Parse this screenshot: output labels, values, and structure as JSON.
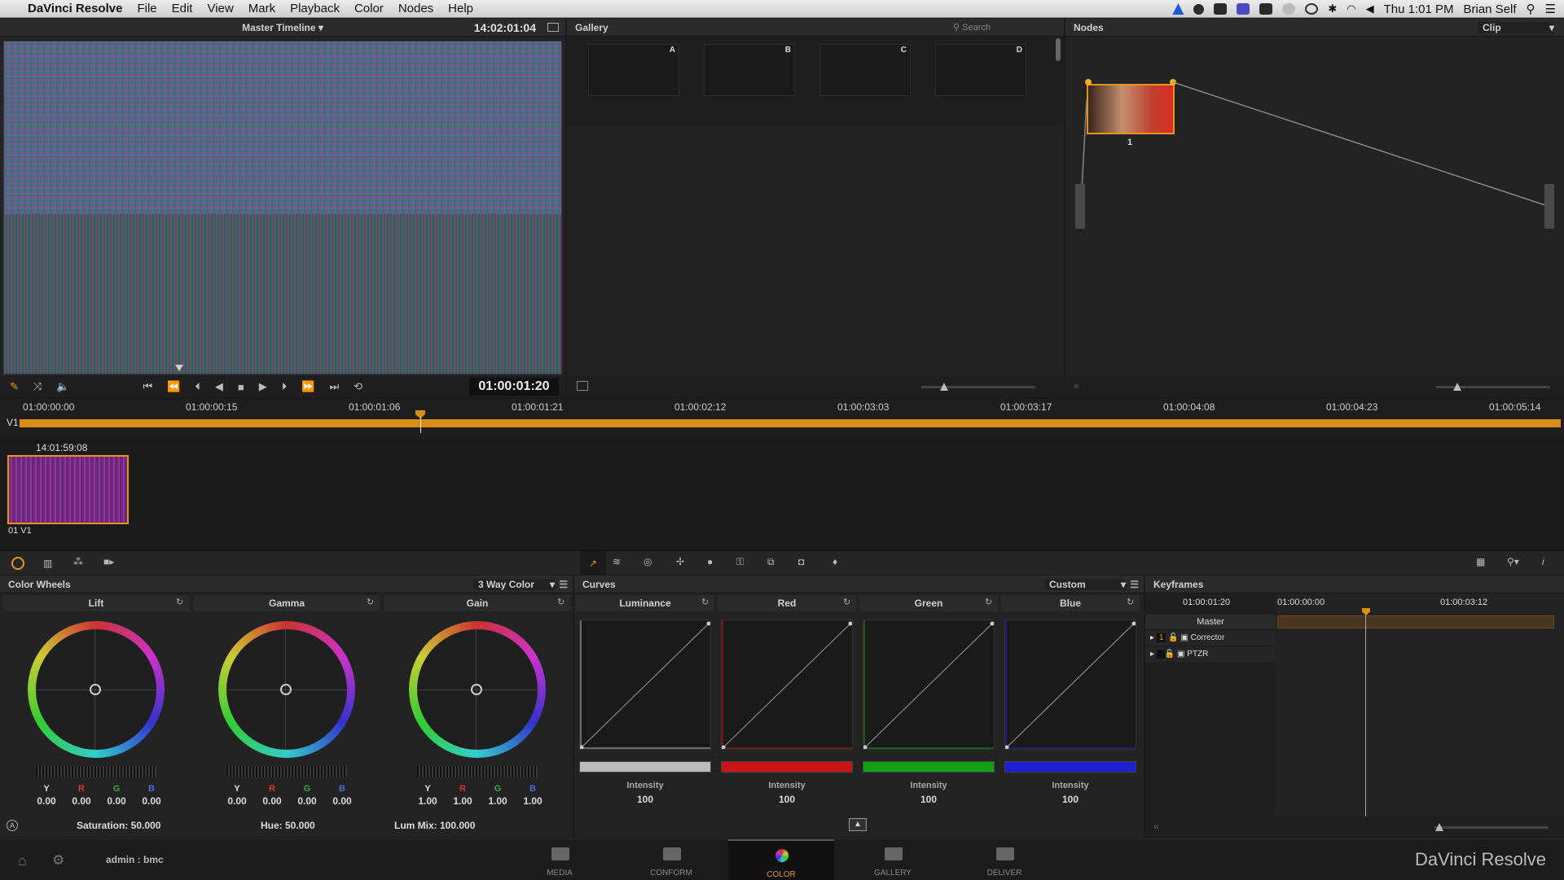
{
  "menubar": {
    "app": "DaVinci Resolve",
    "items": [
      "File",
      "Edit",
      "View",
      "Mark",
      "Playback",
      "Color",
      "Nodes",
      "Help"
    ],
    "clock": "Thu 1:01 PM",
    "user": "Brian Self"
  },
  "viewer": {
    "timeline_name": "Master Timeline",
    "source_tc": "14:02:01:04",
    "record_tc": "01:00:01:20"
  },
  "gallery": {
    "title": "Gallery",
    "search": "Search",
    "stills": [
      "A",
      "B",
      "C",
      "D"
    ]
  },
  "nodes": {
    "title": "Nodes",
    "mode": "Clip",
    "node_label": "1"
  },
  "timeline": {
    "track": "V1",
    "ticks": [
      "01:00:00:00",
      "01:00:00:15",
      "01:00:01:06",
      "01:00:01:21",
      "01:00:02:12",
      "01:00:03:03",
      "01:00:03:17",
      "01:00:04:08",
      "01:00:04:23",
      "01:00:05:14"
    ],
    "playhead_fraction": 0.26
  },
  "clip": {
    "tc": "14:01:59:08",
    "label": "01 V1"
  },
  "color_wheels": {
    "title": "Color Wheels",
    "mode": "3 Way Color",
    "wheels": [
      {
        "name": "Lift",
        "y": "0.00",
        "r": "0.00",
        "g": "0.00",
        "b": "0.00"
      },
      {
        "name": "Gamma",
        "y": "0.00",
        "r": "0.00",
        "g": "0.00",
        "b": "0.00"
      },
      {
        "name": "Gain",
        "y": "1.00",
        "r": "1.00",
        "g": "1.00",
        "b": "1.00"
      }
    ],
    "channel_labels": {
      "y": "Y",
      "r": "R",
      "g": "G",
      "b": "B"
    },
    "saturation": "Saturation: 50.000",
    "hue": "Hue: 50.000",
    "lummix": "Lum Mix: 100.000"
  },
  "curves": {
    "title": "Curves",
    "mode": "Custom",
    "channels": [
      {
        "name": "Luminance",
        "intensity_label": "Intensity",
        "intensity": "100",
        "color": "#bbbbbb"
      },
      {
        "name": "Red",
        "intensity_label": "Intensity",
        "intensity": "100",
        "color": "#c81414"
      },
      {
        "name": "Green",
        "intensity_label": "Intensity",
        "intensity": "100",
        "color": "#14a014"
      },
      {
        "name": "Blue",
        "intensity_label": "Intensity",
        "intensity": "100",
        "color": "#1e1ed2"
      }
    ]
  },
  "keyframes": {
    "title": "Keyframes",
    "current_tc": "01:00:01:20",
    "start_tc": "01:00:00:00",
    "end_tc": "01:00:03:12",
    "rows": [
      "Master",
      "Corrector",
      "PTZR"
    ],
    "corrector_num": "1"
  },
  "bottom": {
    "user": "admin : bmc",
    "brand": "DaVinci Resolve",
    "pages": [
      "MEDIA",
      "CONFORM",
      "COLOR",
      "GALLERY",
      "DELIVER"
    ],
    "active": "COLOR"
  }
}
